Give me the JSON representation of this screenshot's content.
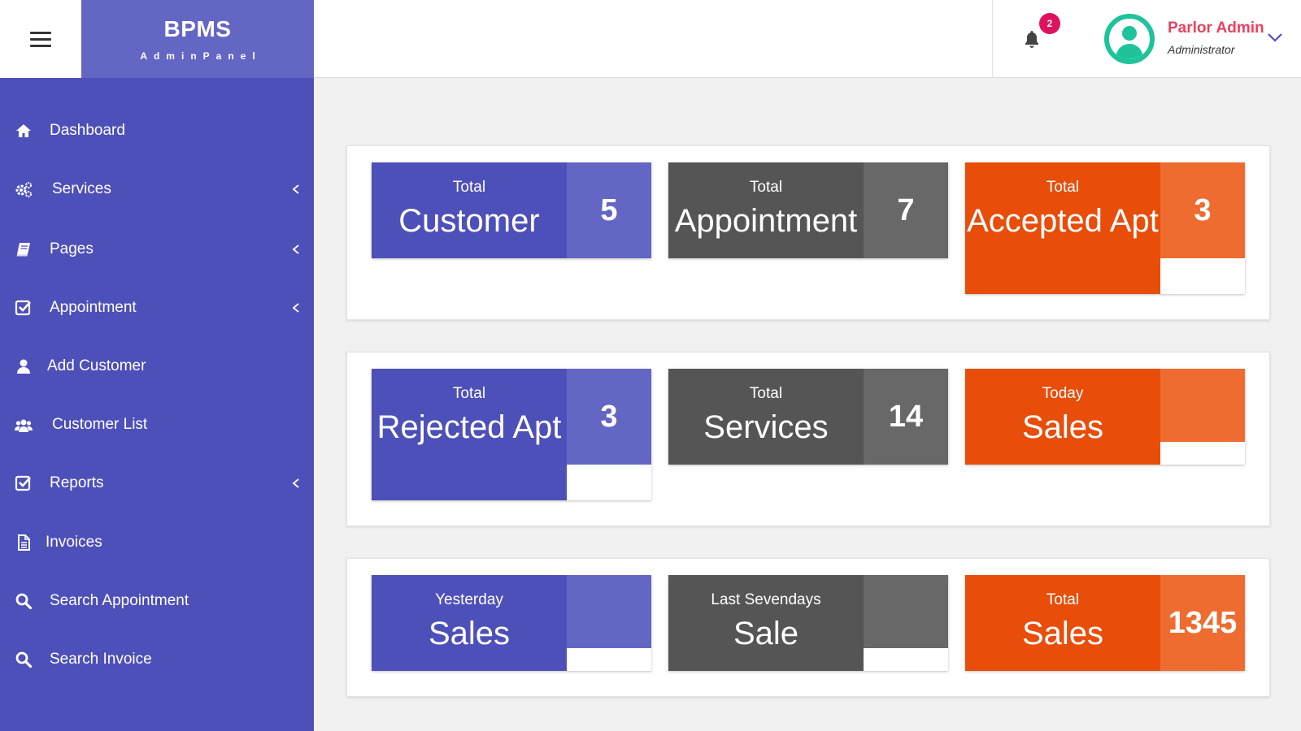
{
  "brand": {
    "name": "BPMS",
    "subtitle": "AdminPanel"
  },
  "header": {
    "notification_count": "2",
    "user_name": "Parlor Admin",
    "user_role": "Administrator",
    "avatar_color": "#1fc39b",
    "badge_color": "#e0115f"
  },
  "sidebar": {
    "color": "#4e50b9",
    "items": [
      {
        "label": "Dashboard",
        "icon": "home-icon",
        "has_submenu": false
      },
      {
        "label": "Services",
        "icon": "gears-icon",
        "has_submenu": true
      },
      {
        "label": "Pages",
        "icon": "book-icon",
        "has_submenu": true
      },
      {
        "label": "Appointment",
        "icon": "check-square-icon",
        "has_submenu": true
      },
      {
        "label": "Add Customer",
        "icon": "user-icon",
        "has_submenu": false
      },
      {
        "label": "Customer List",
        "icon": "users-icon",
        "has_submenu": false
      },
      {
        "label": "Reports",
        "icon": "check-square-icon",
        "has_submenu": true
      },
      {
        "label": "Invoices",
        "icon": "file-icon",
        "has_submenu": false
      },
      {
        "label": "Search Appointment",
        "icon": "search-icon",
        "has_submenu": false
      },
      {
        "label": "Search Invoice",
        "icon": "search-icon",
        "has_submenu": false
      }
    ]
  },
  "stats": [
    {
      "top": "Total",
      "title": "Customer",
      "value": "5",
      "theme": "blue"
    },
    {
      "top": "Total",
      "title": "Appointment",
      "value": "7",
      "theme": "gray"
    },
    {
      "top": "Total",
      "title": "Accepted Apt",
      "value": "3",
      "theme": "orange"
    },
    {
      "top": "Total",
      "title": "Rejected Apt",
      "value": "3",
      "theme": "blue"
    },
    {
      "top": "Total",
      "title": "Services",
      "value": "14",
      "theme": "gray"
    },
    {
      "top": "Today",
      "title": "Sales",
      "value": "",
      "theme": "orange"
    },
    {
      "top": "Yesterday",
      "title": "Sales",
      "value": "",
      "theme": "blue"
    },
    {
      "top": "Last Sevendays",
      "title": "Sale",
      "value": "",
      "theme": "gray"
    },
    {
      "top": "Total",
      "title": "Sales",
      "value": "1345",
      "theme": "orange"
    }
  ],
  "colors": {
    "blue": "#4e50b9",
    "blue_light": "#6466c4",
    "gray": "#555555",
    "gray_light": "#686868",
    "orange": "#e84d0a",
    "orange_light": "#ee6c30"
  }
}
